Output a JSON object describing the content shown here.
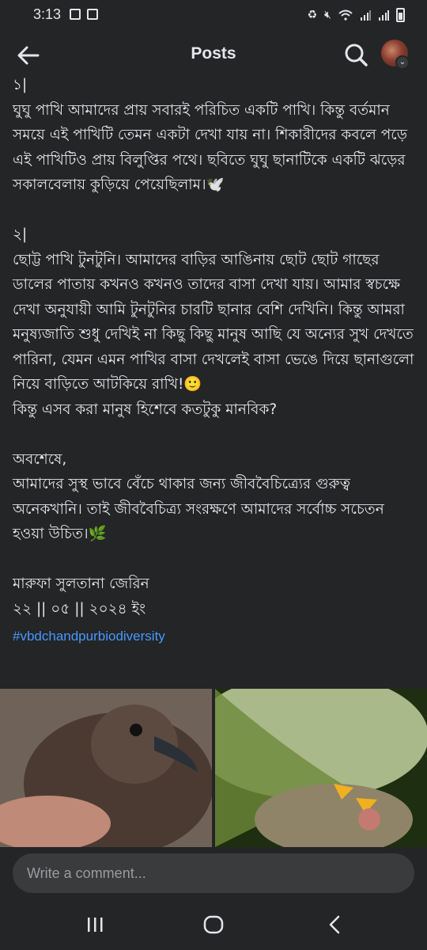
{
  "status_bar": {
    "time": "3:13",
    "left_icons": [
      "image-icon",
      "check-square-icon"
    ],
    "right_icons": [
      "recycle-icon",
      "mute-icon",
      "wifi-icon",
      "signal-icon",
      "signal-icon",
      "battery-icon"
    ]
  },
  "header": {
    "title": "Posts",
    "back_icon": "arrow-left-icon",
    "search_icon": "search-icon"
  },
  "post": {
    "paragraphs": [
      "১|\nঘুঘু পাখি আমাদের প্রায় সবারই পরিচিত একটি পাখি। কিন্তু বর্তমান সময়ে এই পাখিটি তেমন একটা দেখা যায় না। শিকারীদের কবলে পড়ে এই পাখিটিও প্রায় বিলুপ্তির পথে। ছবিতে ঘুঘু ছানাটিকে একটি ঝড়ের সকালবেলায় কুড়িয়ে পেয়েছিলাম।🕊️",
      "২|\nছোট্ট পাখি টুনটুনি। আমাদের বাড়ির আঙিনায় ছোট ছোট গাছের ডালের পাতায় কখনও কখনও তাদের বাসা দেখা যায়। আমার স্বচক্ষে দেখা অনুযায়ী আমি টুনটুনির চারটি ছানার বেশি দেখিনি। কিন্তু আমরা মনুষ্যজাতি শুধু দেখিই না কিছু কিছু মানুষ আছি যে অন্যের সুখ দেখতে পারিনা, যেমন এমন পাখির বাসা দেখলেই বাসা ভেঙে দিয়ে ছানাগুলো নিয়ে বাড়িতে আটকিয়ে রাখি!🙂\nকিন্তু এসব করা মানুষ হিশেবে কতটুকু মানবিক?",
      "অবশেষে,\nআমাদের সুস্থ ভাবে বেঁচে থাকার জন্য জীববৈচিত্র্যের গুরুত্ব অনেকখানি। তাই জীববৈচিত্র্য সংরক্ষণে আমাদের সর্বোচ্চ সচেতন হওয়া উচিত।🌿",
      "মারুফা সুলতানা জেরিন\n২২ || ০৫ || ২০২৪ ইং"
    ],
    "hashtag": "#vbdchandpurbiodiversity"
  },
  "photos": [
    {
      "subject": "dove chick photo"
    },
    {
      "subject": "tailorbird nest photo"
    }
  ],
  "comment": {
    "placeholder": "Write a comment..."
  },
  "nav": {
    "recent_icon": "recent-apps-icon",
    "home_icon": "home-icon",
    "back_icon": "nav-back-icon"
  },
  "colors": {
    "background": "#242526",
    "text": "#e4e6eb",
    "hashtag": "#4599ff",
    "input_bg": "#3a3b3c"
  }
}
